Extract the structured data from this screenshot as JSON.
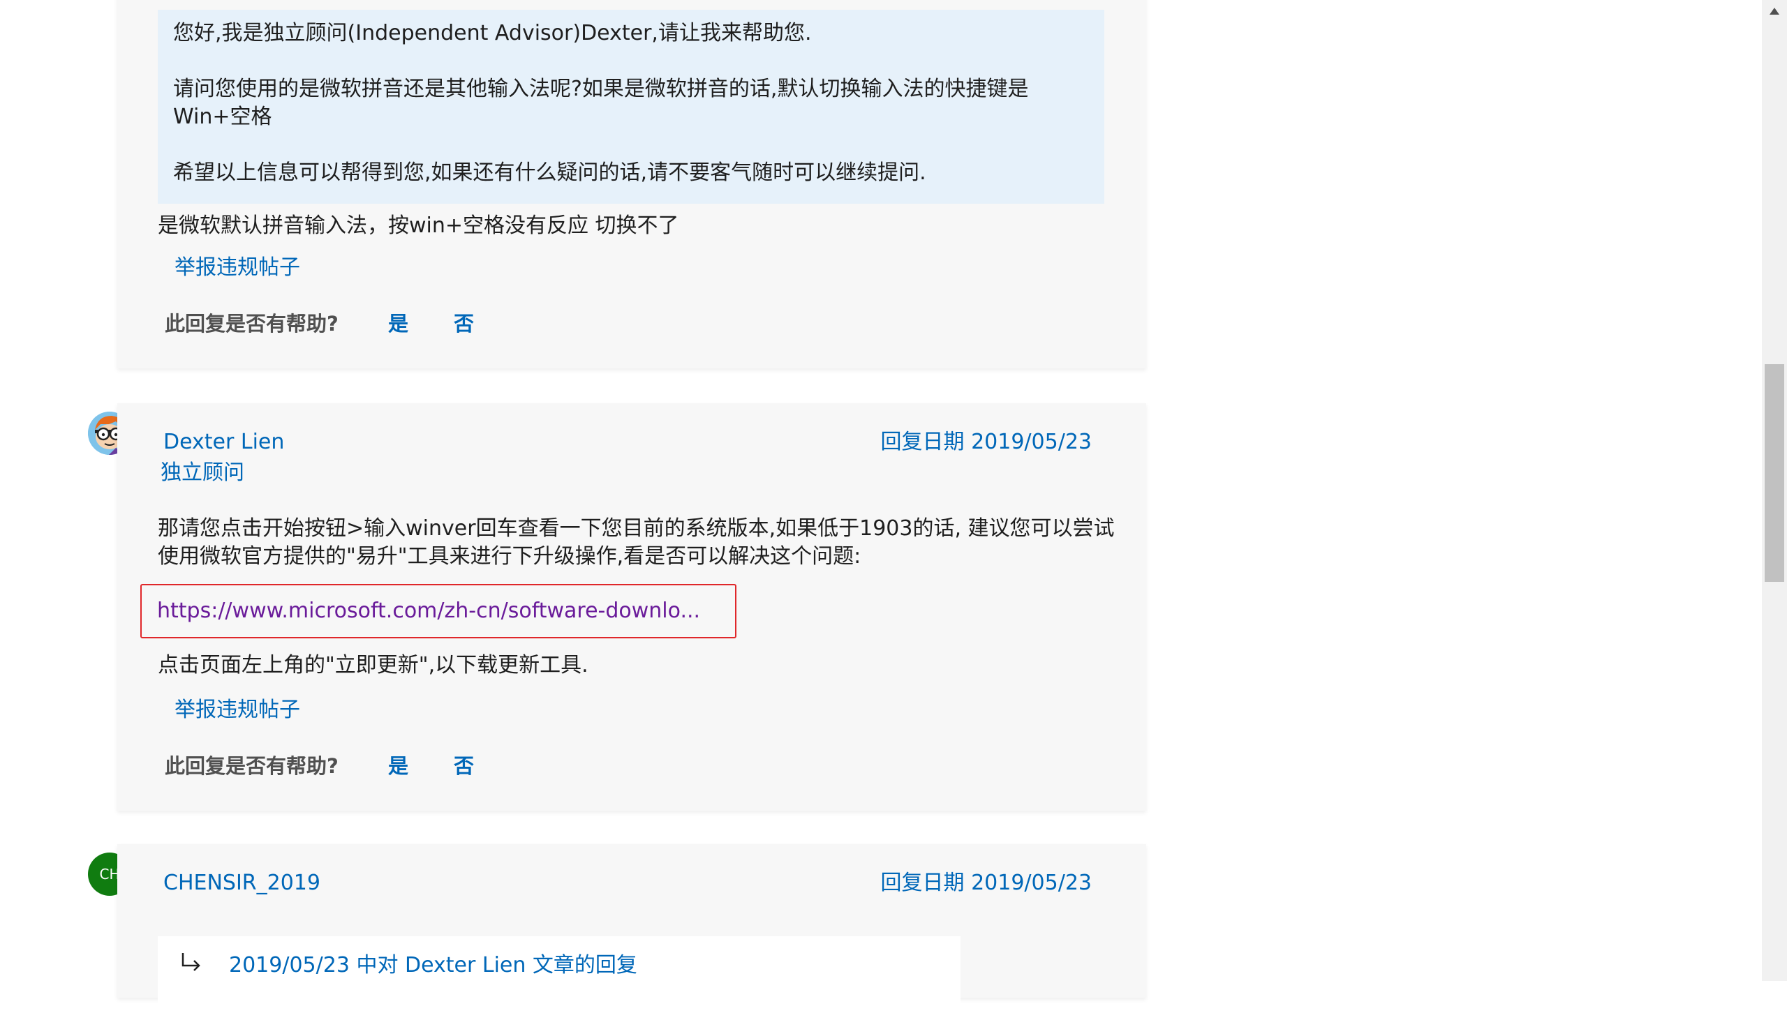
{
  "posts": [
    {
      "quote_paragraphs": [
        "您好,我是独立顾问(Independent Advisor)Dexter,请让我来帮助您.",
        "请问您使用的是微软拼音还是其他输入法呢?如果是微软拼音的话,默认切换输入法的快捷键是\nWin+空格",
        "希望以上信息可以帮得到您,如果还有什么疑问的话,请不要客气随时可以继续提问."
      ],
      "body": "是微软默认拼音输入法，按win+空格没有反应  切换不了",
      "report_label": "举报违规帖子",
      "helpful_label": "此回复是否有帮助?",
      "yes_label": "是",
      "no_label": "否"
    },
    {
      "author": "Dexter Lien",
      "role": "独立顾问",
      "date": "回复日期 2019/05/23",
      "body_lines": [
        "那请您点击开始按钮>输入winver回车查看一下您目前的系统版本,如果低于1903的话, 建议您可以尝试",
        "使用微软官方提供的\"易升\"工具来进行下升级操作,看是否可以解决这个问题:"
      ],
      "link_text": "https://www.microsoft.com/zh-cn/software-downlo...",
      "after_link": "点击页面左上角的\"立即更新\",以下载更新工具.",
      "report_label": "举报违规帖子",
      "helpful_label": "此回复是否有帮助?",
      "yes_label": "是",
      "no_label": "否",
      "avatar_icon": "cartoon-scientist-avatar"
    },
    {
      "author": "CHENSIR_2019",
      "avatar_initials": "CH",
      "avatar_color": "#107c10",
      "date": "回复日期 2019/05/23",
      "reply_ref": "2019/05/23 中对 Dexter Lien 文章的回复",
      "reply_icon": "reply-arrow-icon"
    }
  ],
  "colors": {
    "link": "#0067b8",
    "visited_link": "#6a1b9a",
    "quote_bg": "#e6f1fa",
    "card_bg": "#f7f7f7",
    "highlight_border": "#e0272a"
  }
}
